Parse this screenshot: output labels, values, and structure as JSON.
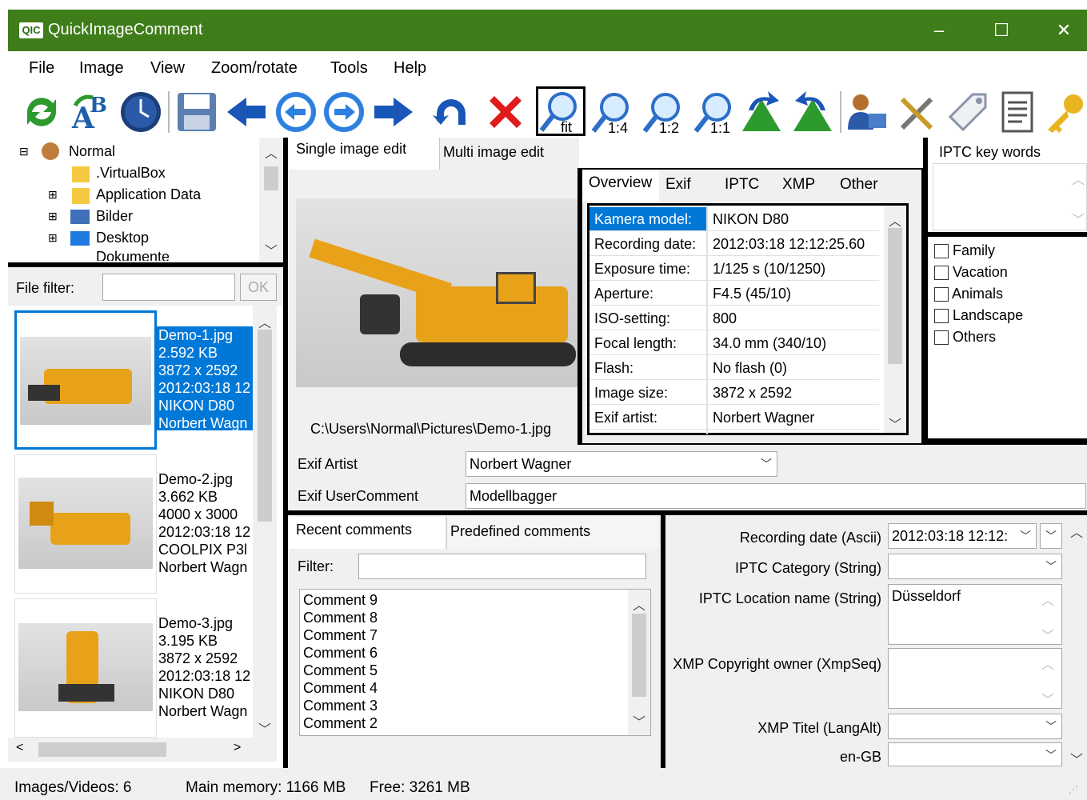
{
  "window": {
    "title": "QuickImageComment",
    "logo": "QIC",
    "minimize": "–",
    "maximize": "☐",
    "close": "✕"
  },
  "menu": [
    "File",
    "Image",
    "View",
    "Zoom/rotate",
    "Tools",
    "Help"
  ],
  "toolbar": {
    "icons": [
      "refresh-icon",
      "rename-icon",
      "clock-icon",
      "save-icon",
      "first-icon",
      "previous-icon",
      "next-icon",
      "last-icon",
      "undo-icon",
      "delete-icon",
      "zoom-fit-icon",
      "zoom-1-4-icon",
      "zoom-1-2-icon",
      "zoom-1-1-icon",
      "rotate-left-icon",
      "rotate-right-icon",
      "user-settings-icon",
      "tools-icon",
      "tag-icon",
      "document-icon",
      "key-icon"
    ],
    "fit": "fit",
    "z14": "1:4",
    "z12": "1:2",
    "z11": "1:1"
  },
  "tree": {
    "items": [
      "Normal",
      ".VirtualBox",
      "Application Data",
      "Bilder",
      "Desktop",
      "Dokumente"
    ]
  },
  "file_filter": {
    "label": "File filter:",
    "value": "",
    "ok": "OK"
  },
  "files": [
    {
      "name": "Demo-1.jpg",
      "size": "2.592 KB",
      "dims": "3872 x 2592",
      "date": "2012:03:18 12",
      "camera": "NIKON D80",
      "artist": "Norbert Wagn"
    },
    {
      "name": "Demo-2.jpg",
      "size": "3.662 KB",
      "dims": "4000 x 3000",
      "date": "2012:03:18 12",
      "camera": "COOLPIX P3l",
      "artist": "Norbert Wagn"
    },
    {
      "name": "Demo-3.jpg",
      "size": "3.195 KB",
      "dims": "3872 x 2592",
      "date": "2012:03:18 12",
      "camera": "NIKON D80",
      "artist": "Norbert Wagn"
    }
  ],
  "edit_tabs": {
    "single": "Single image edit",
    "multi": "Multi image edit"
  },
  "image_path": "C:\\Users\\Normal\\Pictures\\Demo-1.jpg",
  "overview_tabs": [
    "Overview",
    "Exif",
    "IPTC",
    "XMP",
    "Other"
  ],
  "overview": [
    {
      "k": "Kamera model:",
      "v": "NIKON D80"
    },
    {
      "k": "Recording date:",
      "v": "2012:03:18 12:12:25.60"
    },
    {
      "k": "Exposure time:",
      "v": "1/125 s (10/1250)"
    },
    {
      "k": "Aperture:",
      "v": "F4.5 (45/10)"
    },
    {
      "k": "ISO-setting:",
      "v": "800"
    },
    {
      "k": "Focal length:",
      "v": "34.0 mm (340/10)"
    },
    {
      "k": "Flash:",
      "v": "No flash (0)"
    },
    {
      "k": "Image size:",
      "v": "3872 x 2592"
    },
    {
      "k": "Exif artist:",
      "v": "Norbert Wagner"
    }
  ],
  "iptc_keywords": {
    "title": "IPTC key words",
    "checks": [
      "Family",
      "Vacation",
      "Animals",
      "Landscape",
      "Others"
    ]
  },
  "exif_artist": {
    "label": "Exif Artist",
    "value": "Norbert Wagner"
  },
  "exif_usercomment": {
    "label": "Exif UserComment",
    "value": "Modellbagger"
  },
  "comment_tabs": {
    "recent": "Recent comments",
    "predefined": "Predefined comments"
  },
  "comment_filter": {
    "label": "Filter:",
    "value": ""
  },
  "comments": [
    "Comment 9",
    "Comment 8",
    "Comment 7",
    "Comment 6",
    "Comment 5",
    "Comment 4",
    "Comment 3",
    "Comment 2"
  ],
  "props": [
    {
      "label": "Recording date (Ascii)",
      "value": "2012:03:18 12:12:"
    },
    {
      "label": "IPTC Category (String)",
      "value": ""
    },
    {
      "label": "IPTC Location name (String)",
      "value": "Düsseldorf"
    },
    {
      "label": "XMP Copyright owner (XmpSeq)",
      "value": ""
    },
    {
      "label": "XMP Titel (LangAlt)",
      "value": ""
    },
    {
      "label": "en-GB",
      "value": ""
    }
  ],
  "status": {
    "images": "Images/Videos: 6",
    "memory": "Main memory: 1166 MB",
    "free": "Free: 3261 MB"
  }
}
